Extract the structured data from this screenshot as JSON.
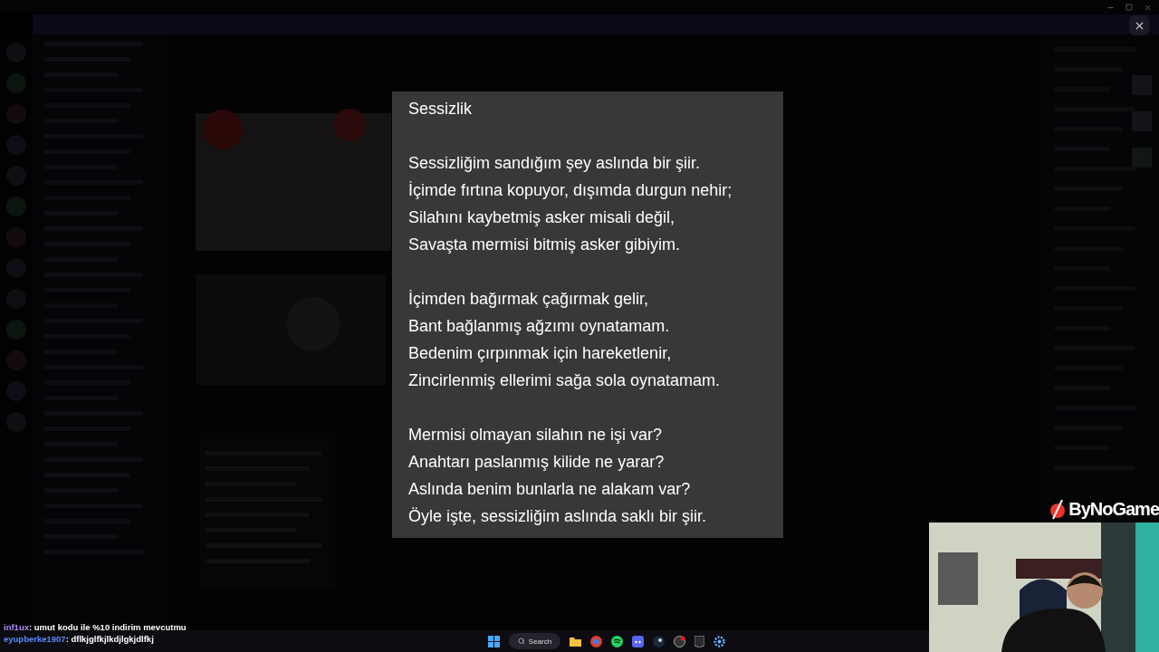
{
  "poem_viewer": {
    "title": "Sessizlik",
    "stanzas": [
      [
        "Sessizliğim sandığım şey aslında bir şiir.",
        "İçimde fırtına kopuyor, dışımda durgun nehir;",
        "Silahını kaybetmiş asker misali değil,",
        "Savaşta mermisi bitmiş asker gibiyim."
      ],
      [
        "İçimden bağırmak çağırmak gelir,",
        "Bant bağlanmış ağzımı oynatamam.",
        "Bedenim çırpınmak için hareketlenir,",
        "Zincirlenmiş ellerimi sağa sola oynatamam."
      ],
      [
        "Mermisi olmayan silahın ne işi var?",
        "Anahtarı paslanmış kilide ne yarar?",
        "Aslında benim bunlarla ne alakam var?",
        "Öyle işte, sessizliğim aslında saklı bir şiir."
      ]
    ]
  },
  "stream_overlay": {
    "logo": "ByNoGame",
    "chat": [
      {
        "user": "inf1ux",
        "color": "#b48cff",
        "text": ": umut kodu ile %10 indirim mevcutmu"
      },
      {
        "user": "eyupberke1907",
        "color": "#5a8cff",
        "text": ": dflkjglfkjlkdjlgkjdlfkj"
      }
    ]
  },
  "taskbar": {
    "search": "Search"
  }
}
